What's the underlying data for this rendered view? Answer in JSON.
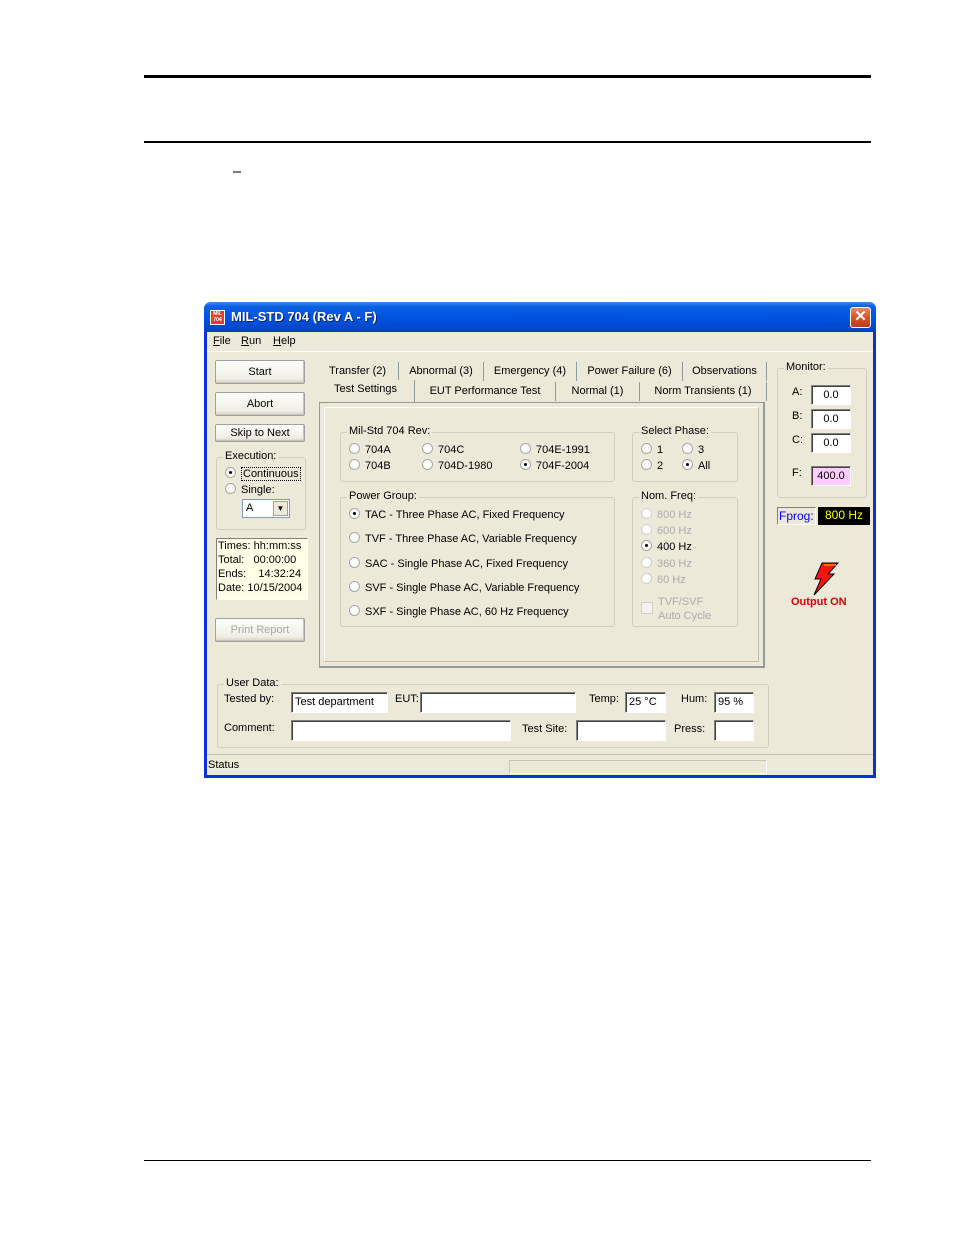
{
  "window": {
    "title": "MIL-STD 704 (Rev A - F)",
    "app_icon_text": "MIL 704",
    "close_icon": "×"
  },
  "menu": {
    "items": [
      {
        "label": "File",
        "accel": "F",
        "rest": "ile"
      },
      {
        "label": "Run",
        "accel": "R",
        "rest": "un"
      },
      {
        "label": "Help",
        "accel": "H",
        "rest": "elp"
      }
    ]
  },
  "controls": {
    "start_label": "Start",
    "abort_label": "Abort",
    "skip_label": "Skip to Next",
    "print_label": "Print Report"
  },
  "execution": {
    "label": "Execution:",
    "continuous": "Continuous",
    "single": "Single:",
    "selected": "Continuous",
    "single_value": "A"
  },
  "times": {
    "header": "Times: hh:mm:ss",
    "total": "Total:   00:00:00",
    "ends": "Ends:    14:32:24",
    "date": "Date: 10/15/2004"
  },
  "tabs": {
    "row1": [
      "Transfer (2)",
      "Abnormal (3)",
      "Emergency (4)",
      "Power Failure (6)",
      "Observations"
    ],
    "row2": [
      "Test Settings",
      "EUT Performance Test",
      "Normal (1)",
      "Norm Transients (1)"
    ],
    "active": "Test Settings"
  },
  "rev": {
    "label": "Mil-Std 704 Rev:",
    "options": [
      "704A",
      "704C",
      "704E-1991",
      "704B",
      "704D-1980",
      "704F-2004"
    ],
    "selected": "704F-2004"
  },
  "phase": {
    "label": "Select Phase:",
    "options": [
      "1",
      "3",
      "2",
      "All"
    ],
    "selected": "All"
  },
  "power_group": {
    "label": "Power Group:",
    "options": [
      "TAC - Three Phase AC, Fixed Frequency",
      "TVF - Three Phase AC, Variable Frequency",
      "SAC - Single Phase AC, Fixed Frequency",
      "SVF - Single Phase AC, Variable Frequency",
      "SXF - Single Phase AC, 60 Hz Frequency"
    ],
    "selected": "TAC - Three Phase AC, Fixed Frequency"
  },
  "nom_freq": {
    "label": "Nom. Freq:",
    "options": [
      "800 Hz",
      "600 Hz",
      "400 Hz",
      "360 Hz",
      "60 Hz"
    ],
    "selected": "400 Hz",
    "auto_cycle_line1": "TVF/SVF",
    "auto_cycle_line2": "Auto Cycle"
  },
  "monitor": {
    "label": "Monitor:",
    "a_label": "A:",
    "a_value": "0.0",
    "b_label": "B:",
    "b_value": "0.0",
    "c_label": "C:",
    "c_value": "0.0",
    "f_label": "F:",
    "f_value": "400.0",
    "f_color": "#ffccff"
  },
  "fprog": {
    "label": "Fprog:",
    "value": "800 Hz"
  },
  "output": {
    "label": "Output ON",
    "icon": "lightning-icon"
  },
  "user_data": {
    "label": "User Data:",
    "tested_by_label": "Tested by:",
    "tested_by_value": "Test department",
    "eut_label": "EUT:",
    "eut_value": "",
    "temp_label": "Temp:",
    "temp_value": "25 °C",
    "hum_label": "Hum:",
    "hum_value": "95 %",
    "comment_label": "Comment:",
    "comment_value": "",
    "test_site_label": "Test Site:",
    "test_site_value": "",
    "press_label": "Press:",
    "press_value": ""
  },
  "status": {
    "text": "Status"
  }
}
